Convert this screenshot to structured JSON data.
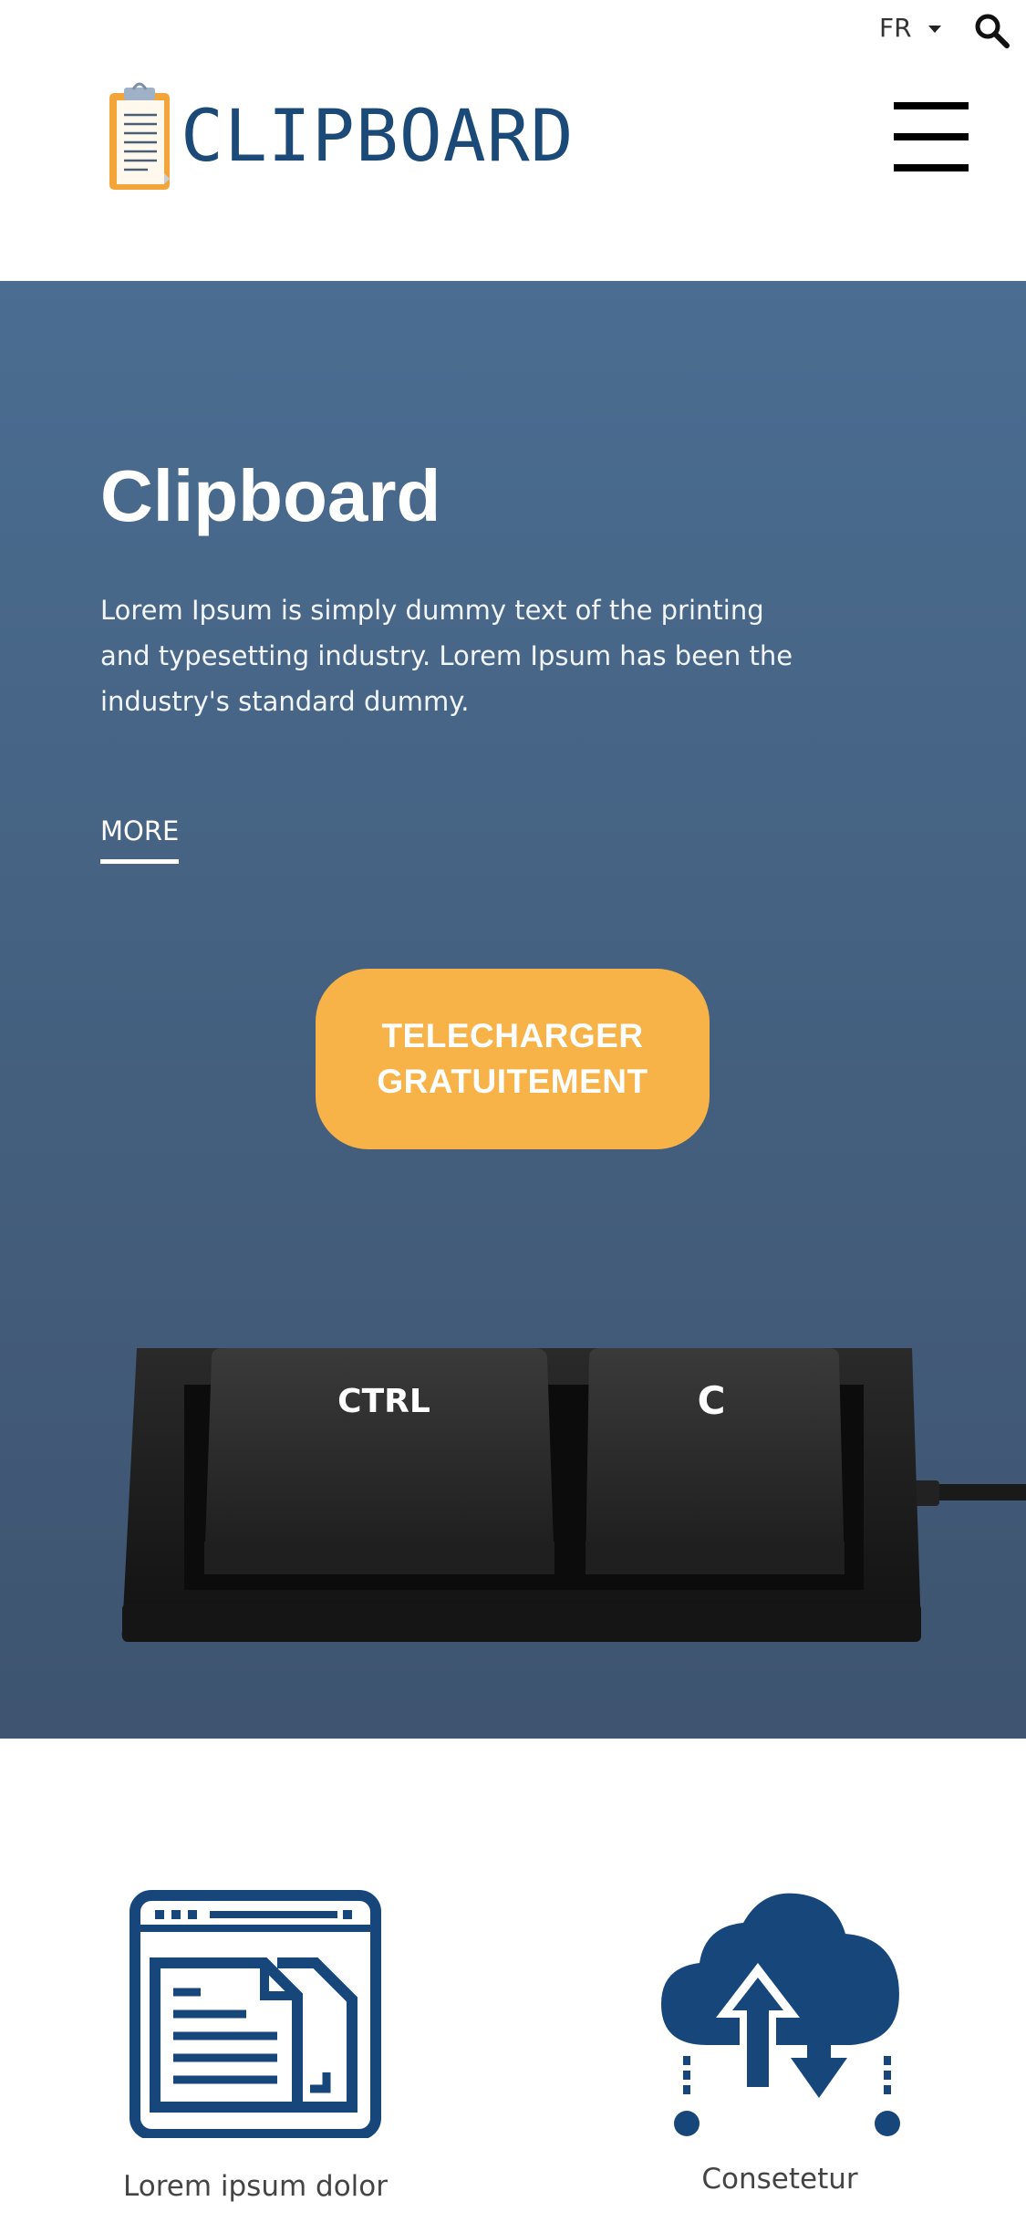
{
  "header": {
    "language": "FR",
    "logo_text": "CLIPBOARD"
  },
  "hero": {
    "title": "Clipboard",
    "description": "Lorem Ipsum is simply dummy text of the printing and typesetting industry. Lorem Ipsum has been the industry's standard dummy.",
    "more_label": "MORE",
    "download_label": "TELECHARGER\nGRATUITEMENT",
    "keys": [
      "CTRL",
      "C"
    ]
  },
  "features": [
    {
      "icon": "documents-window-icon",
      "label": "Lorem ipsum dolor"
    },
    {
      "icon": "cloud-sync-icon",
      "label": "Consetetur"
    }
  ],
  "colors": {
    "brand_blue": "#1b4a78",
    "hero_bg": "#4a6d91",
    "button_orange": "#f7b248",
    "icon_blue": "#17477a"
  }
}
